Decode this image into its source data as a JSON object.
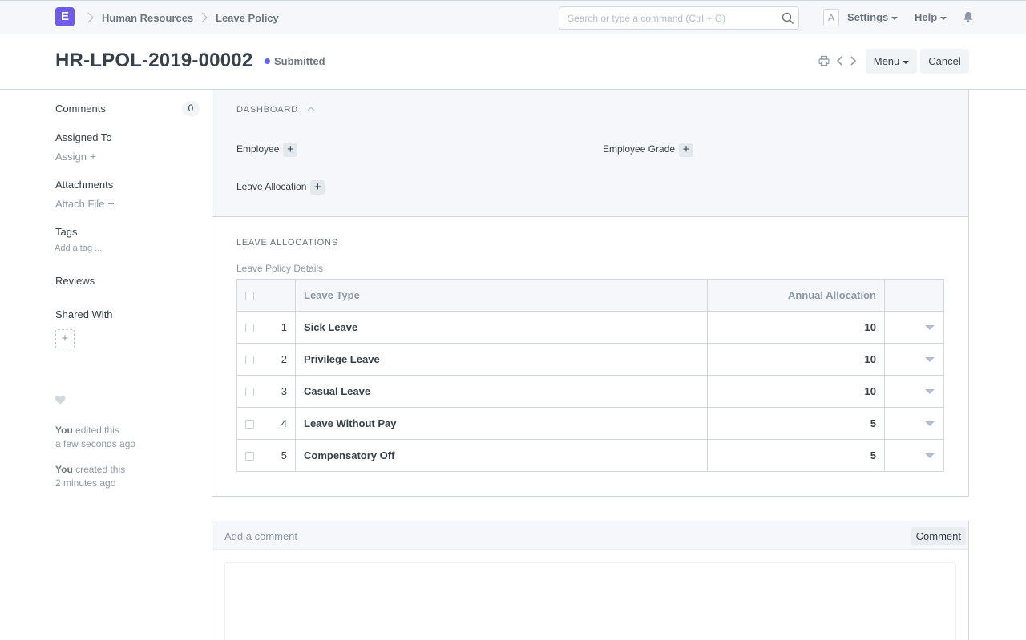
{
  "navbar": {
    "logo_letter": "E",
    "breadcrumbs": [
      "Human Resources",
      "Leave Policy"
    ],
    "search_placeholder": "Search or type a command (Ctrl + G)",
    "avatar_letter": "A",
    "settings_label": "Settings",
    "help_label": "Help"
  },
  "page": {
    "title": "HR-LPOL-2019-00002",
    "status": "Submitted",
    "status_color": "#5e64ff",
    "menu_label": "Menu",
    "cancel_label": "Cancel"
  },
  "sidebar": {
    "comments_label": "Comments",
    "comments_count": "0",
    "assigned_to_label": "Assigned To",
    "assign_action": "Assign",
    "attachments_label": "Attachments",
    "attach_action": "Attach File",
    "tags_label": "Tags",
    "add_tag_action": "Add a tag ...",
    "reviews_label": "Reviews",
    "shared_with_label": "Shared With",
    "timeline": [
      {
        "who": "You",
        "action": " edited this",
        "when": "a few seconds ago"
      },
      {
        "who": "You",
        "action": " created this",
        "when": "2 minutes ago"
      }
    ]
  },
  "dashboard": {
    "title": "DASHBOARD",
    "links": [
      "Employee",
      "Employee Grade",
      "Leave Allocation"
    ]
  },
  "leave_allocations": {
    "section_title": "LEAVE ALLOCATIONS",
    "field_label": "Leave Policy Details",
    "columns": [
      "Leave Type",
      "Annual Allocation"
    ],
    "rows": [
      {
        "idx": "1",
        "leave_type": "Sick Leave",
        "allocation": "10"
      },
      {
        "idx": "2",
        "leave_type": "Privilege Leave",
        "allocation": "10"
      },
      {
        "idx": "3",
        "leave_type": "Casual Leave",
        "allocation": "10"
      },
      {
        "idx": "4",
        "leave_type": "Leave Without Pay",
        "allocation": "5"
      },
      {
        "idx": "5",
        "leave_type": "Compensatory Off",
        "allocation": "5"
      }
    ]
  },
  "comment": {
    "label": "Add a comment",
    "button": "Comment"
  }
}
